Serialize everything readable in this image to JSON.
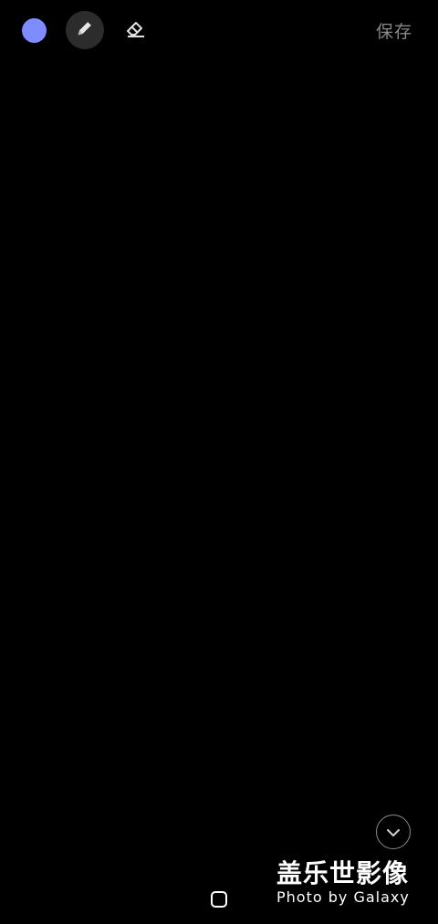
{
  "toolbar": {
    "color_swatch": "#7f8cff",
    "pen_icon": "pen-icon",
    "eraser_icon": "eraser-icon",
    "save_label": "保存"
  },
  "scroll_button": {
    "icon": "chevron-down-icon"
  },
  "watermark": {
    "title": "盖乐世影像",
    "subtitle": "Photo by Galaxy"
  },
  "navbar": {
    "home_icon": "home-icon"
  }
}
